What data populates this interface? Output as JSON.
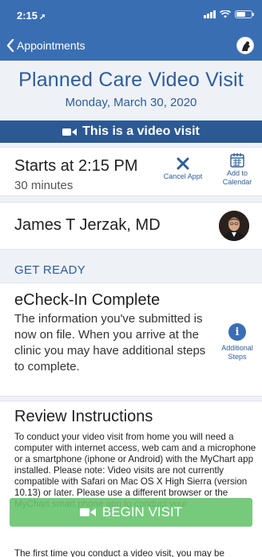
{
  "status_bar": {
    "time": "2:15",
    "location_glyph": "➚"
  },
  "nav": {
    "back_label": "Appointments"
  },
  "header": {
    "title": "Planned Care Video Visit",
    "date": "Monday, March 30, 2020"
  },
  "banner": {
    "text": "This is a video visit"
  },
  "appointment": {
    "starts": "Starts at 2:15 PM",
    "duration": "30 minutes",
    "cancel_label": "Cancel Appt",
    "add_calendar_line1": "Add to",
    "add_calendar_line2": "Calendar"
  },
  "provider": {
    "name": "James T Jerzak, MD"
  },
  "section": {
    "get_ready": "GET READY"
  },
  "echeck": {
    "title": "eCheck-In Complete",
    "body": "The information you've submitted is now on file. When you arrive at the clinic you may have additional steps to complete.",
    "steps_line1": "Additional",
    "steps_line2": "Steps"
  },
  "review": {
    "title": "Review Instructions",
    "body": "To conduct your video visit from home you will need a computer with internet access, web cam and a microphone or a smartphone (iphone or Android) with the MyChart app installed. Please note: Video visits are not currently compatible with Safari on Mac OS X High Sierra (version 10.13) or later. Please use a different browser or the MyChart smart phone app to conduct your",
    "more": "The first time you conduct a video visit, you may be"
  },
  "cta": {
    "begin_label": "BEGIN VISIT"
  },
  "colors": {
    "header_blue": "#3a6eb3",
    "banner_blue": "#2c5993",
    "accent_text": "#2e5d9a",
    "cta_green": "#67c46e"
  },
  "icons": [
    "location-arrow-icon",
    "signal-icon",
    "wifi-icon",
    "battery-icon",
    "chevron-left-icon",
    "avatar-icon",
    "video-camera-icon",
    "close-icon",
    "calendar-add-icon",
    "info-icon"
  ]
}
